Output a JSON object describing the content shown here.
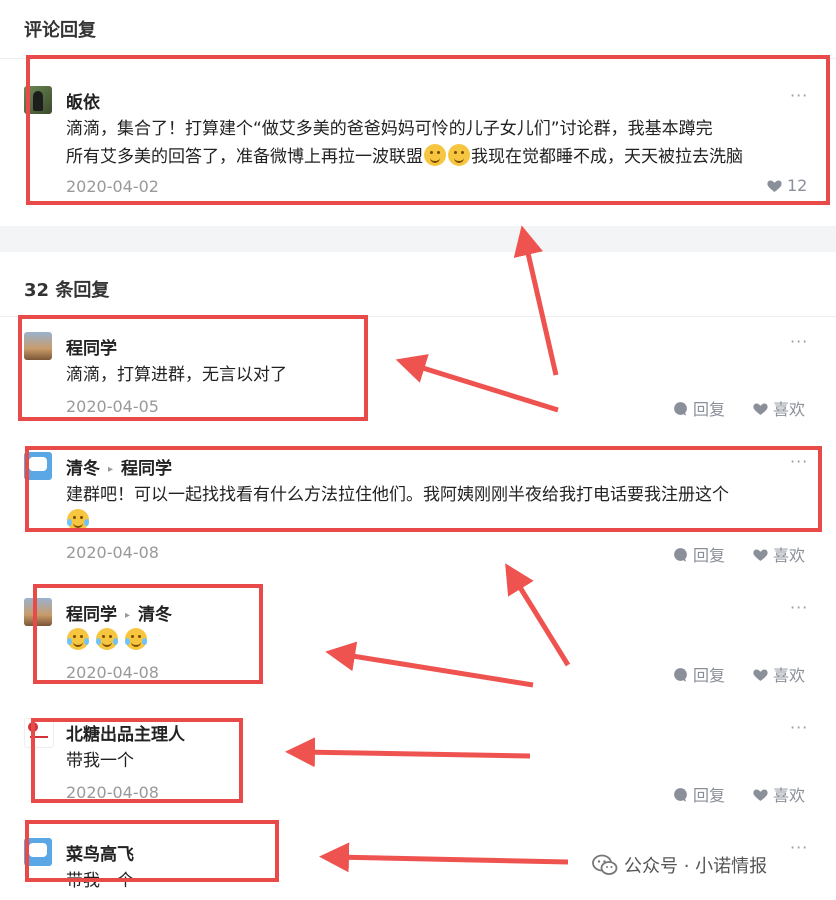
{
  "comments_section": {
    "title": "评论回复"
  },
  "main_comment": {
    "author": "皈依",
    "text_line1": "滴滴，集合了！打算建个“做艾多美的爸爸妈妈可怜的儿子女儿们”讨论群，我基本蹲完",
    "text_line2a": "所有艾多美的回答了，准备微博上再拉一波联盟",
    "text_line2b": "我现在觉都睡不成，天天被拉去洗脑",
    "date": "2020-04-02",
    "likes": "12",
    "more": "···"
  },
  "replies_section": {
    "title": "32 条回复"
  },
  "replies": [
    {
      "author": "程同学",
      "reply_to": "",
      "text": "滴滴，打算进群，无言以对了",
      "date": "2020-04-05"
    },
    {
      "author": "清冬",
      "reply_to": "程同学",
      "text": "建群吧！可以一起找找看有什么方法拉住他们。我阿姨刚刚半夜给我打电话要我注册这个",
      "date": "2020-04-08"
    },
    {
      "author": "程同学",
      "reply_to": "清冬",
      "text": "",
      "date": "2020-04-08"
    },
    {
      "author": "北糖出品主理人",
      "reply_to": "",
      "text": "带我一个",
      "date": "2020-04-08"
    },
    {
      "author": "菜鸟高飞",
      "reply_to": "",
      "text": "带我一个",
      "date": ""
    }
  ],
  "actions": {
    "reply": "回复",
    "like": "喜欢",
    "more": "···"
  },
  "watermark": {
    "text": "公众号 · 小诺情报"
  },
  "colors": {
    "highlight": "#e84a4a",
    "arrow": "#ef5350",
    "muted": "#999999"
  }
}
